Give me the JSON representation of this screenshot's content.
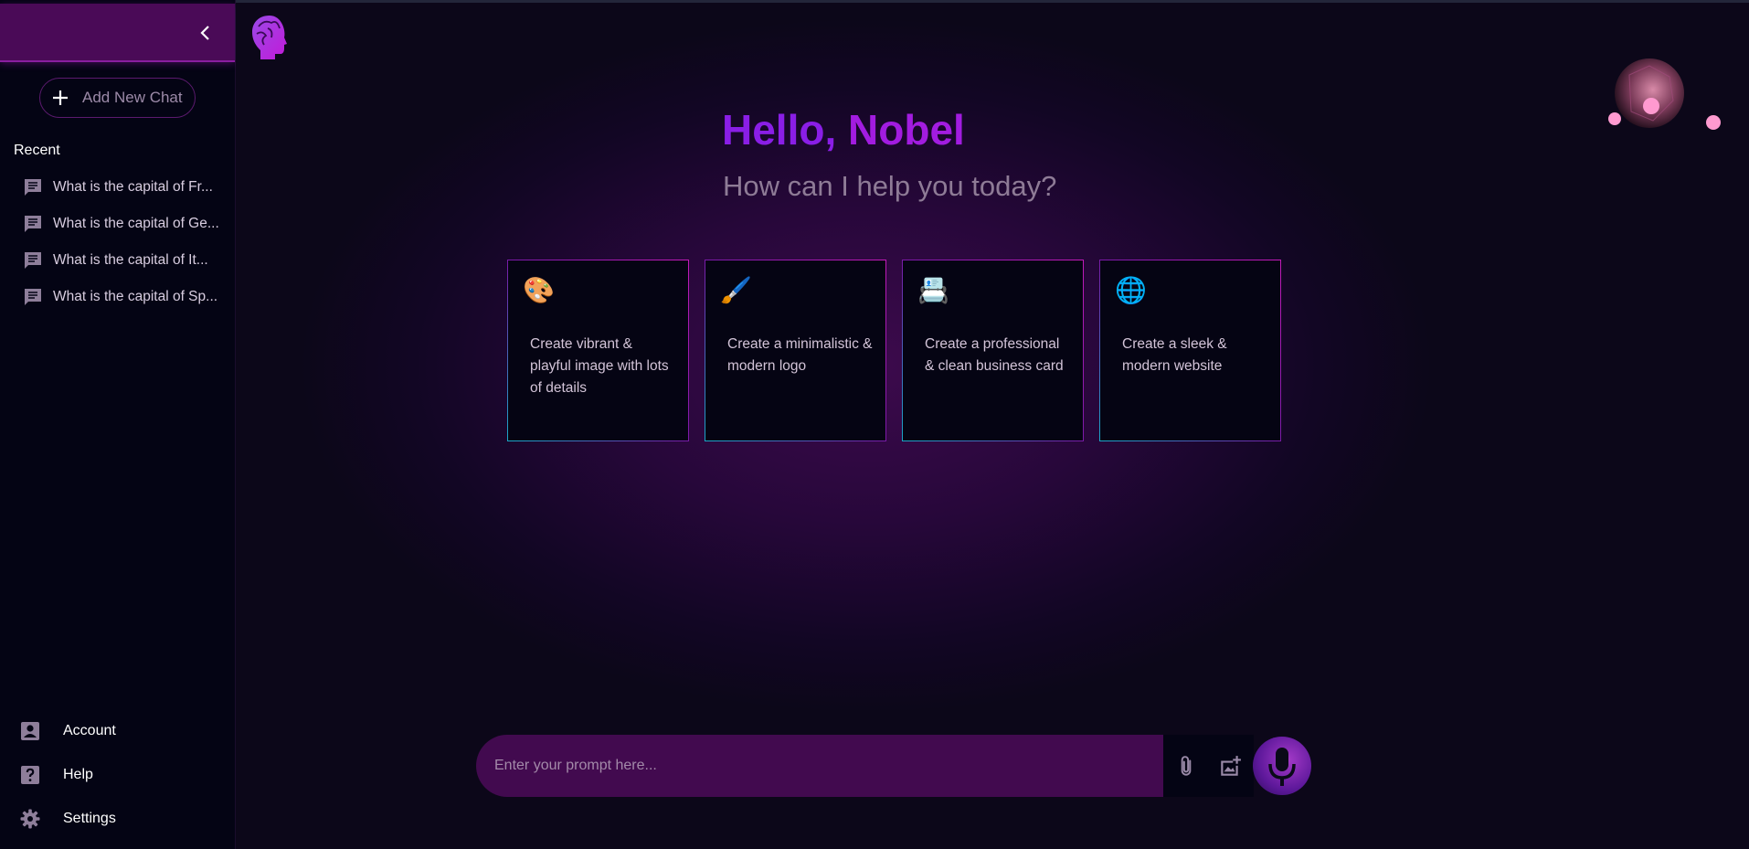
{
  "sidebar": {
    "add_new_chat": "Add New Chat",
    "recent_title": "Recent",
    "recent": [
      {
        "label": "What is the capital of Fr..."
      },
      {
        "label": "What is the capital of Ge..."
      },
      {
        "label": "What is the capital of It..."
      },
      {
        "label": "What is the capital of Sp..."
      }
    ],
    "bottom": [
      {
        "label": "Account",
        "icon": "account-icon"
      },
      {
        "label": "Help",
        "icon": "help-icon"
      },
      {
        "label": "Settings",
        "icon": "settings-icon"
      }
    ]
  },
  "main": {
    "greeting_prefix": "Hello, ",
    "greeting_name": "Nobel",
    "subtitle": "How can I help you today?",
    "cards": [
      {
        "emoji": "🎨",
        "text": "Create vibrant & playful image with lots of details"
      },
      {
        "emoji": "🖌️",
        "text": "Create a minimalistic & modern logo"
      },
      {
        "emoji": "📇",
        "text": "Create a professional & clean business card"
      },
      {
        "emoji": "🌐",
        "text": "Create a sleek & modern website"
      }
    ]
  },
  "prompt": {
    "placeholder": "Enter your prompt here..."
  },
  "colors": {
    "accent": "#8a1ee6",
    "sidebar_bg": "#040414",
    "sidebar_header": "#4a0a57",
    "prompt_bg": "#420a4f"
  }
}
